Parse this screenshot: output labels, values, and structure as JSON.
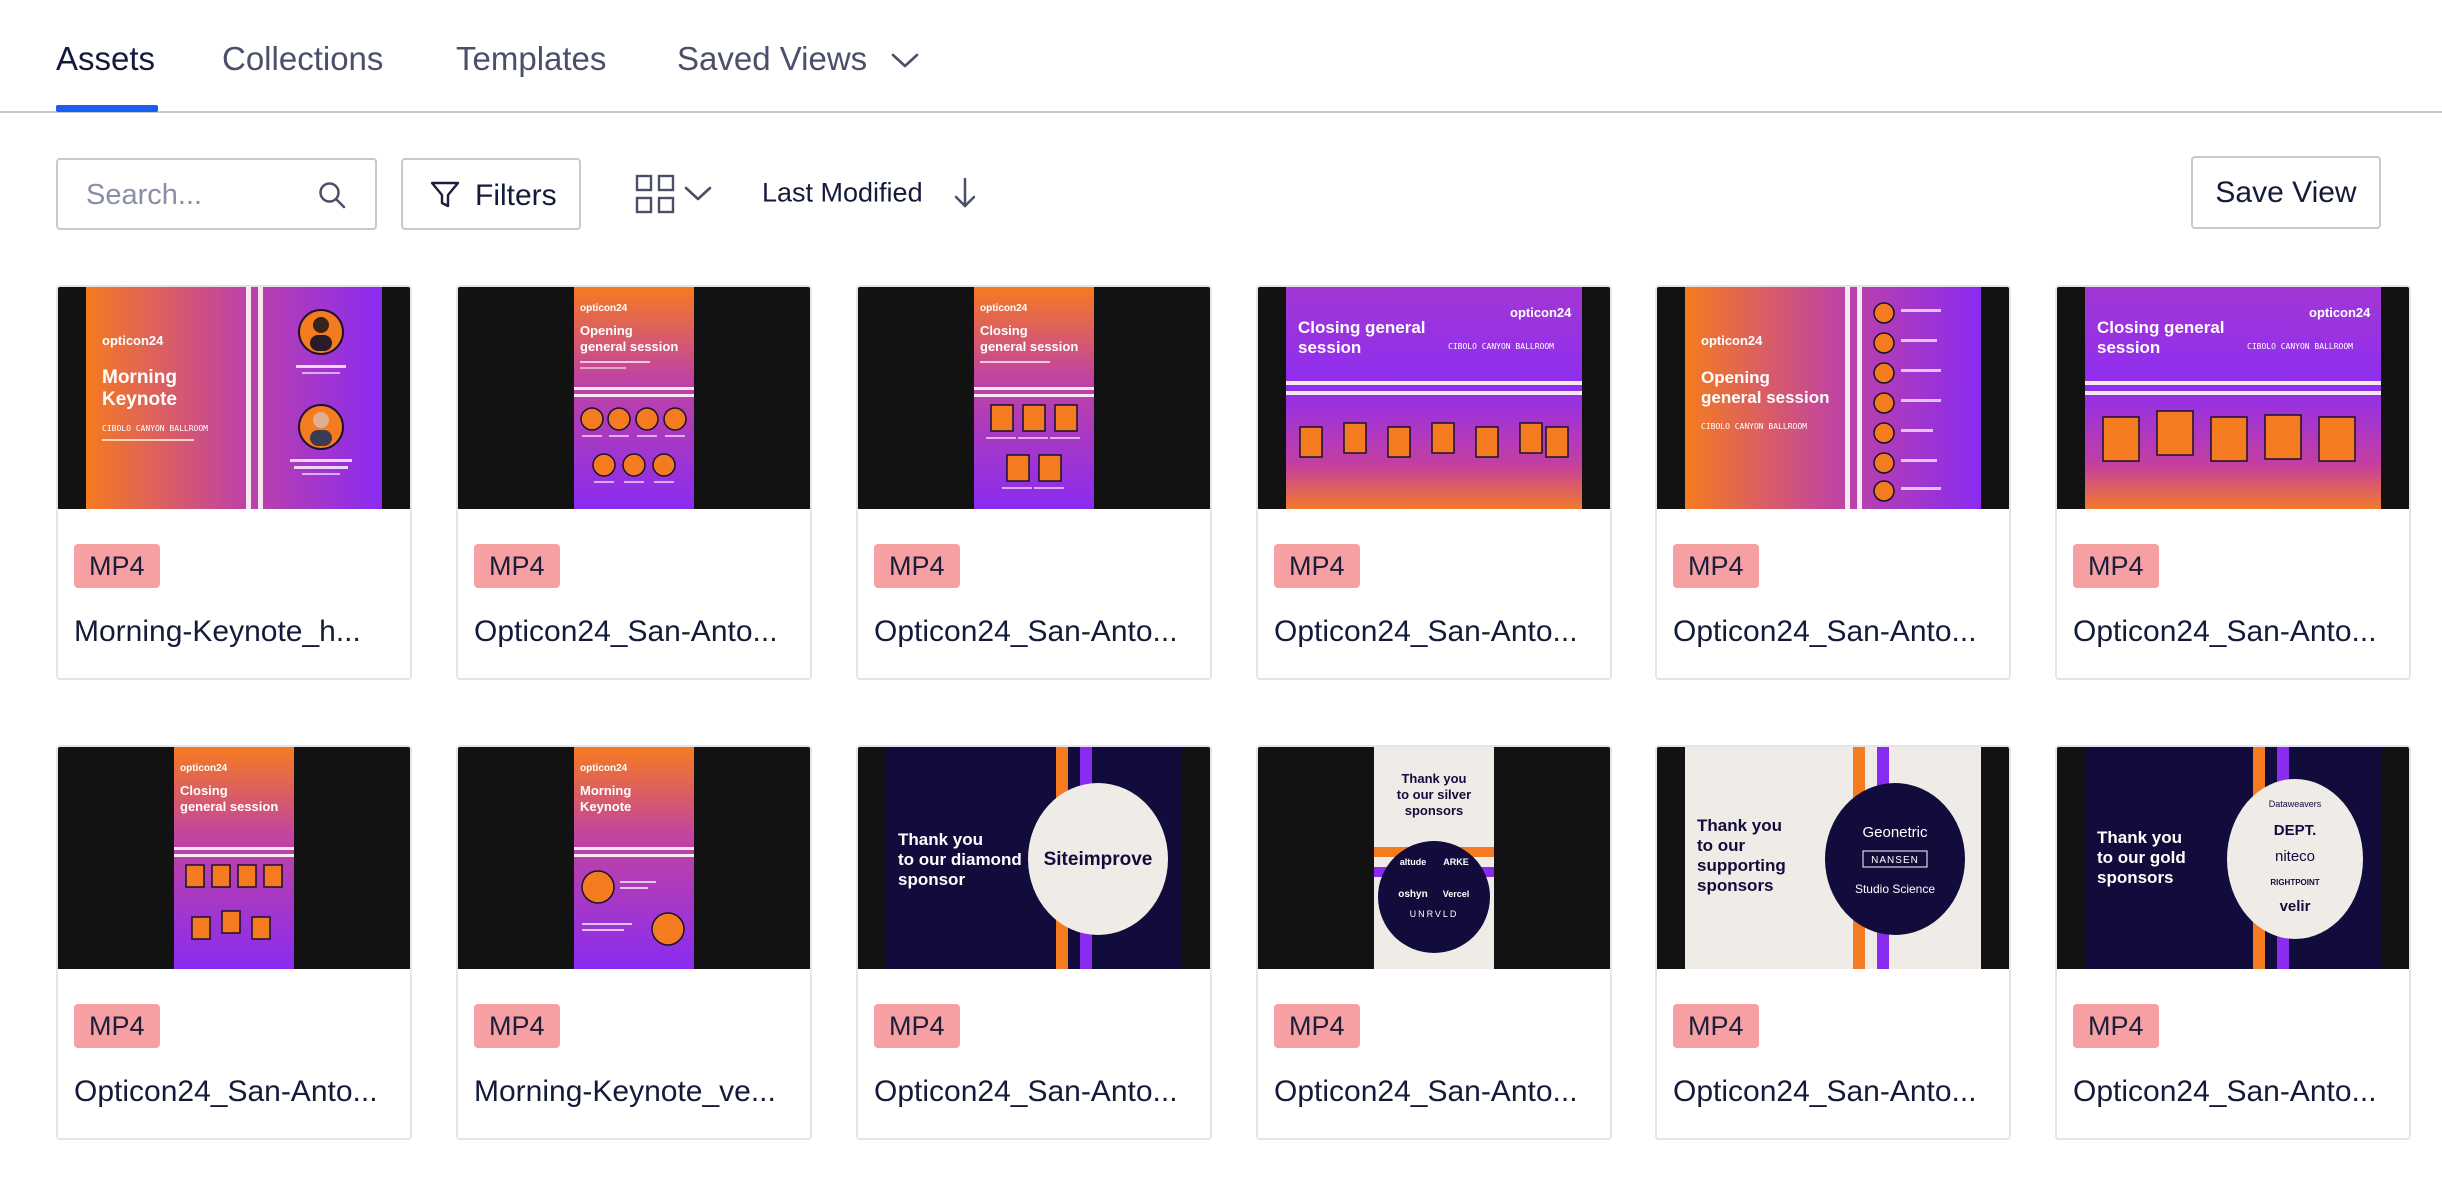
{
  "tabs": [
    {
      "label": "Assets",
      "active": true
    },
    {
      "label": "Collections",
      "active": false
    },
    {
      "label": "Templates",
      "active": false
    },
    {
      "label": "Saved Views",
      "active": false
    }
  ],
  "toolbar": {
    "search_placeholder": "Search...",
    "filters_label": "Filters",
    "sort_label": "Last Modified",
    "save_view_label": "Save View"
  },
  "assets": [
    {
      "type": "MP4",
      "name": "Morning-Keynote_h...",
      "thumb": {
        "brand": "opticon24",
        "title": [
          "Morning",
          "Keynote"
        ],
        "room": "CIBOLO CANYON BALLROOM"
      }
    },
    {
      "type": "MP4",
      "name": "Opticon24_San-Anto...",
      "thumb": {
        "brand": "opticon24",
        "title": [
          "Opening",
          "general session"
        ]
      }
    },
    {
      "type": "MP4",
      "name": "Opticon24_San-Anto...",
      "thumb": {
        "brand": "opticon24",
        "title": [
          "Closing",
          "general session"
        ]
      }
    },
    {
      "type": "MP4",
      "name": "Opticon24_San-Anto...",
      "thumb": {
        "brand": "opticon24",
        "title": [
          "Closing general",
          "session"
        ],
        "room": "CIBOLO CANYON BALLROOM"
      }
    },
    {
      "type": "MP4",
      "name": "Opticon24_San-Anto...",
      "thumb": {
        "brand": "opticon24",
        "title": [
          "Opening",
          "general session"
        ],
        "room": "CIBOLO CANYON BALLROOM"
      }
    },
    {
      "type": "MP4",
      "name": "Opticon24_San-Anto...",
      "thumb": {
        "brand": "opticon24",
        "title": [
          "Closing general",
          "session"
        ],
        "room": "CIBOLO CANYON BALLROOM"
      }
    },
    {
      "type": "MP4",
      "name": "Opticon24_San-Anto...",
      "thumb": {
        "brand": "opticon24",
        "title": [
          "Closing",
          "general session"
        ]
      }
    },
    {
      "type": "MP4",
      "name": "Morning-Keynote_ve...",
      "thumb": {
        "brand": "opticon24",
        "title": [
          "Morning",
          "Keynote"
        ]
      }
    },
    {
      "type": "MP4",
      "name": "Opticon24_San-Anto...",
      "thumb": {
        "title": [
          "Thank you",
          "to our diamond",
          "sponsor"
        ],
        "sponsors": [
          "Siteimprove"
        ]
      }
    },
    {
      "type": "MP4",
      "name": "Opticon24_San-Anto...",
      "thumb": {
        "title": [
          "Thank you",
          "to our silver",
          "sponsors"
        ],
        "sponsors": [
          "altude",
          "ARKE",
          "oshyn",
          "Vercel",
          "UNRVLD"
        ]
      }
    },
    {
      "type": "MP4",
      "name": "Opticon24_San-Anto...",
      "thumb": {
        "title": [
          "Thank you",
          "to our",
          "supporting",
          "sponsors"
        ],
        "sponsors": [
          "Geonetric",
          "NANSEN",
          "Studio Science"
        ]
      }
    },
    {
      "type": "MP4",
      "name": "Opticon24_San-Anto...",
      "thumb": {
        "title": [
          "Thank you",
          "to our gold",
          "sponsors"
        ],
        "sponsors": [
          "Dataweavers",
          "DEPT.",
          "niteco",
          "RIGHTPOINT",
          "velir"
        ]
      }
    }
  ],
  "colors": {
    "accent": "#1a5ef3",
    "badge": "#f7a0a3",
    "orange": "#f57b20",
    "purple": "#8a2bf0",
    "navy": "#120c3c"
  }
}
